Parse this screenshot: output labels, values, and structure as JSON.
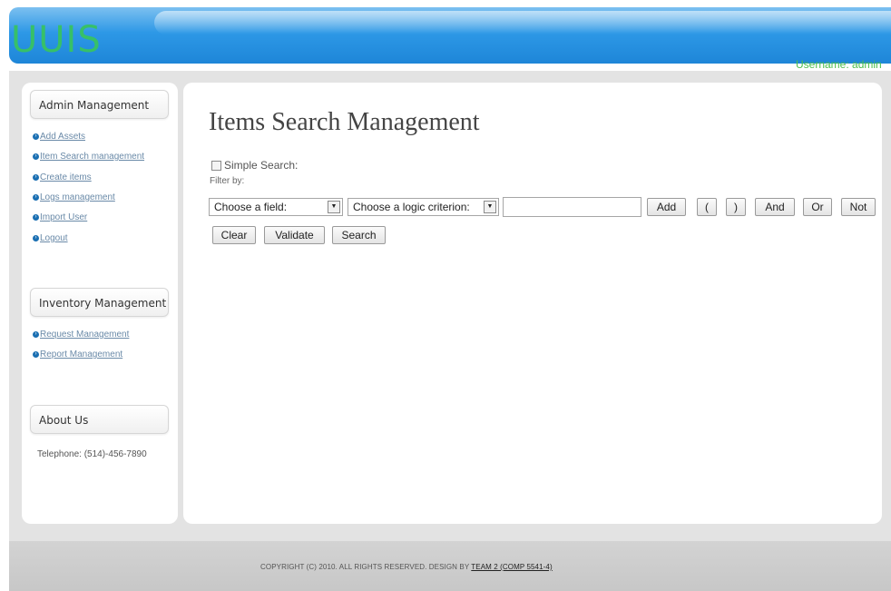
{
  "header": {
    "logo": "UUIS",
    "username": "Username: admin"
  },
  "sidebar": {
    "admin": {
      "title": "Admin Management",
      "items": [
        {
          "label": "Add Assets"
        },
        {
          "label": "Item Search management"
        },
        {
          "label": "Create items"
        },
        {
          "label": "Logs management"
        },
        {
          "label": "Import User"
        },
        {
          "label": "Logout"
        }
      ]
    },
    "inventory": {
      "title": "Inventory Management",
      "items": [
        {
          "label": "Request Management"
        },
        {
          "label": "Report Management"
        }
      ]
    },
    "about": {
      "title": "About Us",
      "telephone": "Telephone: (514)-456-7890"
    }
  },
  "main": {
    "title": "Items Search Management",
    "simple_search_label": "Simple Search:",
    "simple_search_checked": false,
    "filter_by_label": "Filter by:",
    "field_select": {
      "selected": "Choose a field:"
    },
    "criterion_select": {
      "selected": "Choose a logic criterion:"
    },
    "value_input": {
      "value": "",
      "placeholder": ""
    },
    "buttons": {
      "add": "Add",
      "open_paren": "(",
      "close_paren": ")",
      "and": "And",
      "or": "Or",
      "not": "Not",
      "clear": "Clear",
      "validate": "Validate",
      "search": "Search"
    }
  },
  "footer": {
    "copyright": "COPYRIGHT (C) 2010. ALL RIGHTS RESERVED. DESIGN BY",
    "team_link": "TEAM 2 (COMP 5541-4)"
  },
  "colors": {
    "header_blue": "#2d98e6",
    "logo_green": "#37c068",
    "username_green": "#4cbf4c",
    "link_color": "#6a8aa8",
    "bullet_blue": "#1a6fb2",
    "page_gray": "#e3e3e3"
  }
}
